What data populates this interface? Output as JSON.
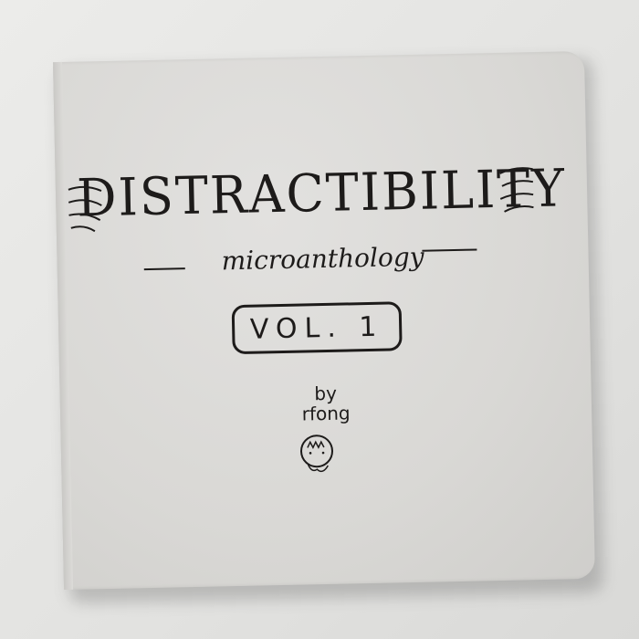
{
  "cover": {
    "title": "DISTRACTIBILITY",
    "subtitle": "microanthology",
    "volume": "VOL. 1",
    "byline": "by",
    "author": "rfong"
  }
}
